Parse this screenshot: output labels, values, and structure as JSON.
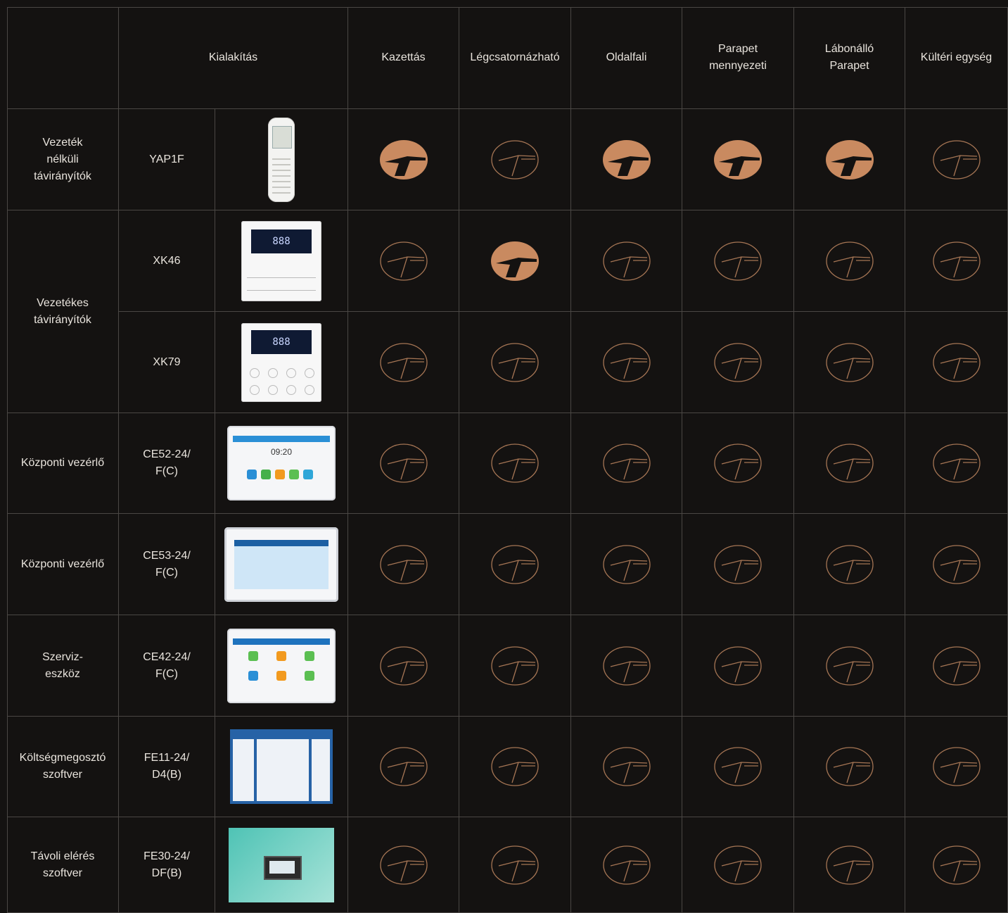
{
  "header": {
    "design_label": "Kialakítás",
    "columns": [
      "Kazettás",
      "Légcsatornázható",
      "Oldalfali",
      "Parapet\nmennyezeti",
      "Lábonálló\nParapet",
      "Kültéri egység"
    ]
  },
  "groups": [
    {
      "label": "Vezeték\nnélküli\ntávirányítók"
    },
    {
      "label": "Vezetékes\ntávirányítók"
    },
    {
      "label": "Központi vezérlő"
    },
    {
      "label": "Központi vezérlő"
    },
    {
      "label": "Szerviz-\neszköz"
    },
    {
      "label": "Költségmegosztó\nszoftver"
    },
    {
      "label": "Távoli elérés\nszoftver"
    }
  ],
  "rows": [
    {
      "model": "YAP1F",
      "thumb": "remote-control-image",
      "compat": [
        true,
        false,
        true,
        true,
        true,
        false
      ]
    },
    {
      "model": "XK46",
      "thumb": "wired-controller-xk46-image",
      "compat": [
        false,
        true,
        false,
        false,
        false,
        false
      ]
    },
    {
      "model": "XK79",
      "thumb": "wired-controller-xk79-image",
      "compat": [
        false,
        false,
        false,
        false,
        false,
        false
      ]
    },
    {
      "model": "CE52-24/\nF(C)",
      "thumb": "central-controller-ce52-image",
      "compat": [
        false,
        false,
        false,
        false,
        false,
        false
      ]
    },
    {
      "model": "CE53-24/\nF(C)",
      "thumb": "central-controller-ce53-image",
      "compat": [
        false,
        false,
        false,
        false,
        false,
        false
      ]
    },
    {
      "model": "CE42-24/\nF(C)",
      "thumb": "service-tool-ce42-image",
      "compat": [
        false,
        false,
        false,
        false,
        false,
        false
      ]
    },
    {
      "model": "FE11-24/\nD4(B)",
      "thumb": "billing-software-image",
      "compat": [
        false,
        false,
        false,
        false,
        false,
        false
      ]
    },
    {
      "model": "FE30-24/\nDF(B)",
      "thumb": "remote-access-software-image",
      "compat": [
        false,
        false,
        false,
        false,
        false,
        false
      ]
    }
  ],
  "thumb_text": {
    "ce52_time": "09:20"
  },
  "colors": {
    "background": "#141211",
    "grid": "#4a4744",
    "icon_fill": "#c98a60",
    "icon_outline": "#a57554"
  },
  "icons": {
    "compatible": "brand-logo-filled-icon",
    "not_compatible": "brand-logo-outline-icon"
  }
}
